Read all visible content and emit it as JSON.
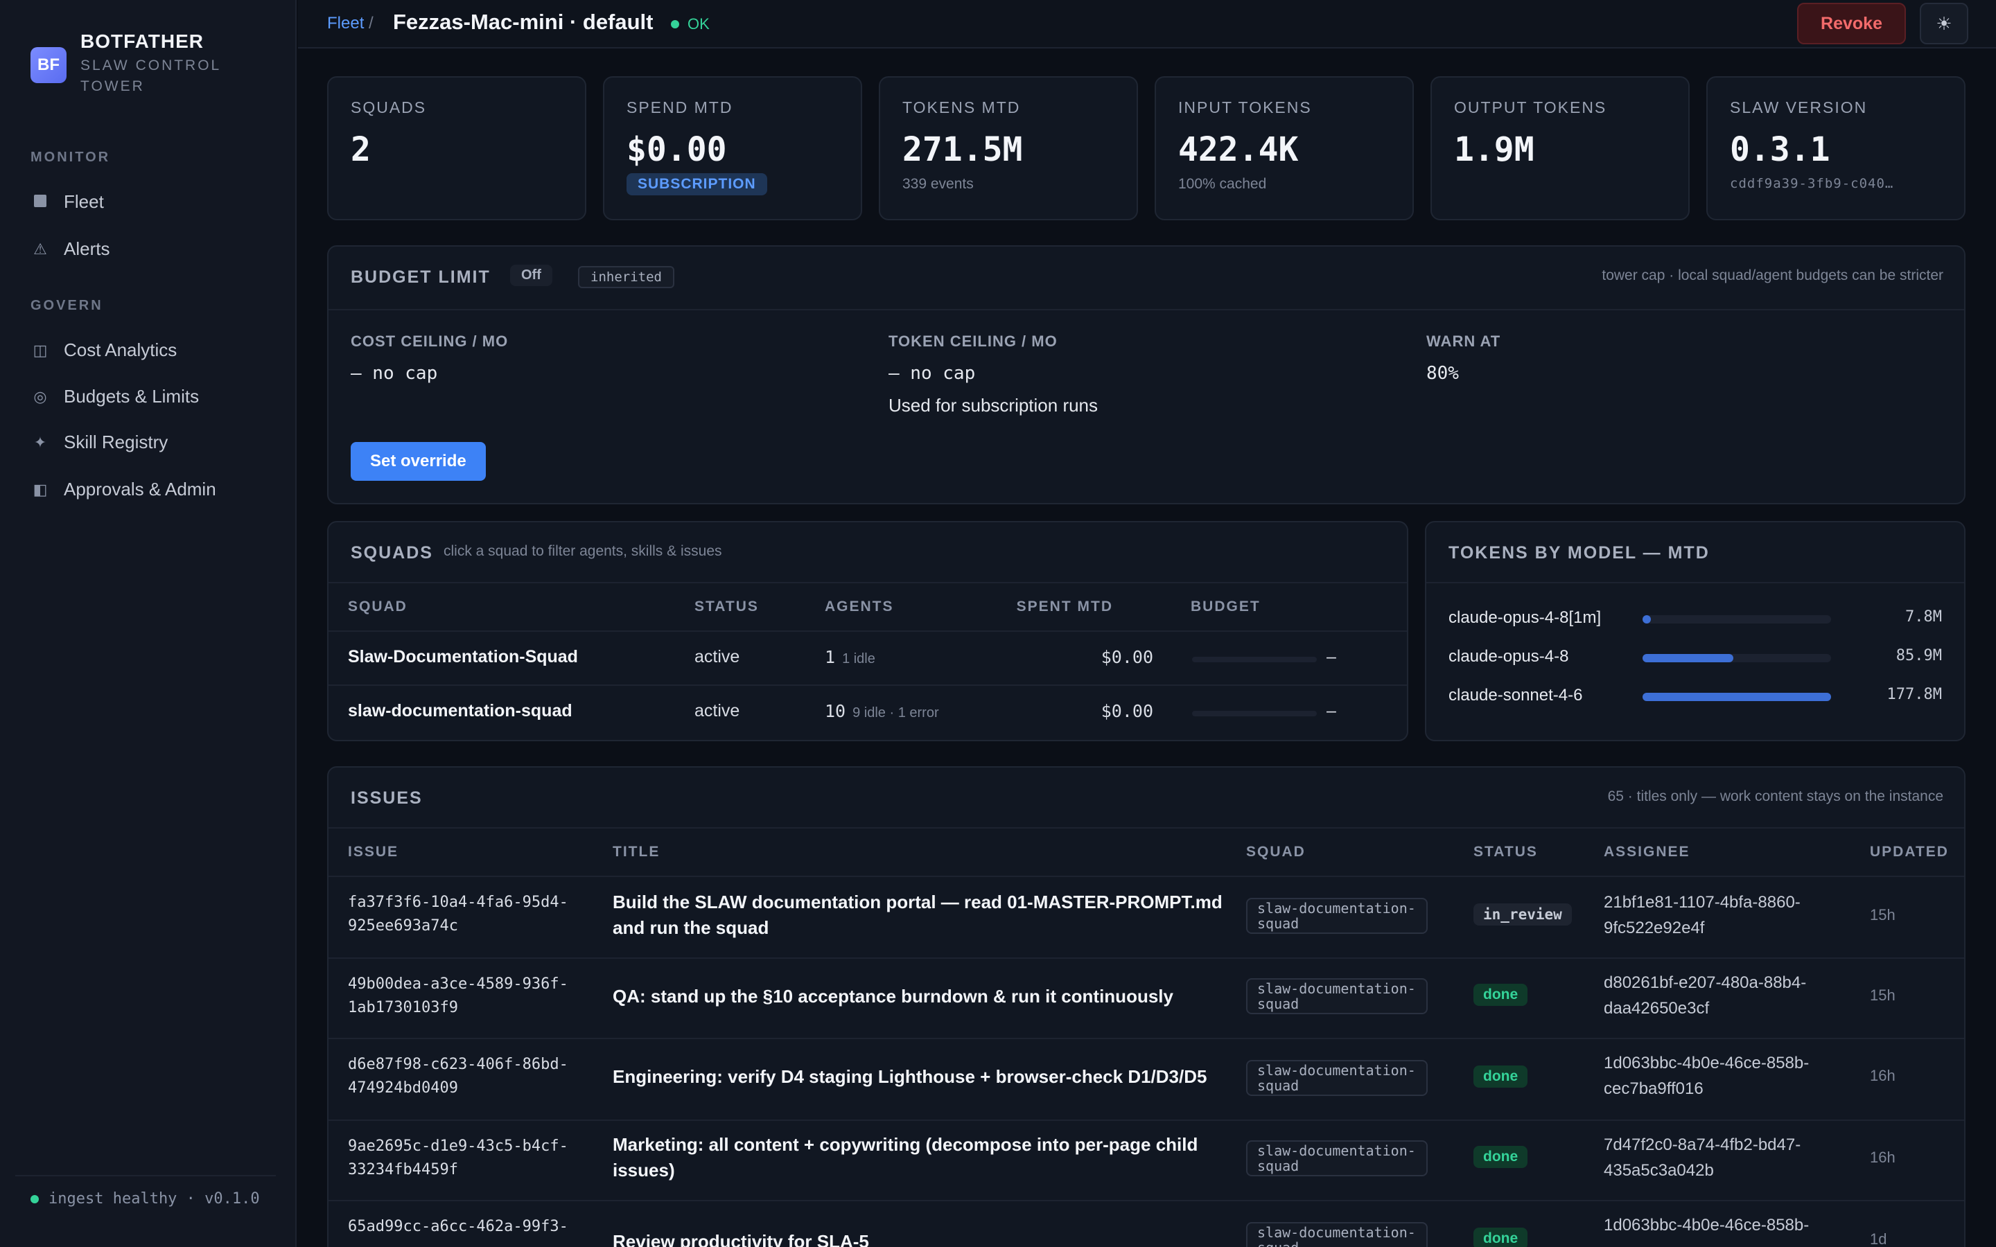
{
  "brand": {
    "logo": "BF",
    "name": "BOTFATHER",
    "subtitle": "SLAW CONTROL TOWER"
  },
  "sidebar": {
    "sections": [
      {
        "label": "MONITOR",
        "items": [
          {
            "label": "Fleet",
            "icon": "square-icon"
          },
          {
            "label": "Alerts",
            "icon": "warning-icon"
          }
        ]
      },
      {
        "label": "GOVERN",
        "items": [
          {
            "label": "Cost Analytics",
            "icon": "columns-icon"
          },
          {
            "label": "Budgets & Limits",
            "icon": "target-icon"
          },
          {
            "label": "Skill Registry",
            "icon": "sparkle-icon"
          },
          {
            "label": "Approvals & Admin",
            "icon": "admin-icon"
          }
        ]
      }
    ],
    "footer": "ingest healthy · v0.1.0"
  },
  "topbar": {
    "breadcrumb": "Fleet",
    "breadcrumb_sep": "/",
    "title": "Fezzas-Mac-mini · default",
    "status": "OK",
    "revoke_label": "Revoke",
    "theme_icon": "☀"
  },
  "stats": [
    {
      "label": "SQUADS",
      "value": "2"
    },
    {
      "label": "SPEND MTD",
      "value": "$0.00",
      "badge": "SUBSCRIPTION"
    },
    {
      "label": "TOKENS MTD",
      "value": "271.5M",
      "sub": "339 events"
    },
    {
      "label": "INPUT TOKENS",
      "value": "422.4K",
      "sub": "100% cached"
    },
    {
      "label": "OUTPUT TOKENS",
      "value": "1.9M"
    },
    {
      "label": "SLAW VERSION",
      "value": "0.3.1",
      "sub": "cddf9a39-3fb9-c040…"
    }
  ],
  "budget": {
    "title": "BUDGET LIMIT",
    "state": "Off",
    "inherited": "inherited",
    "hint": "tower cap · local squad/agent budgets can be stricter",
    "fields": [
      {
        "label": "COST CEILING / MO",
        "value": "— no cap"
      },
      {
        "label": "TOKEN CEILING / MO",
        "value": "— no cap",
        "note": "Used for subscription runs"
      },
      {
        "label": "WARN AT",
        "value": "80%"
      }
    ],
    "button": "Set override"
  },
  "squads": {
    "title": "SQUADS",
    "hint": "click a squad to filter agents, skills & issues",
    "columns": [
      "SQUAD",
      "STATUS",
      "AGENTS",
      "SPENT MTD",
      "BUDGET"
    ],
    "rows": [
      {
        "name": "Slaw-Documentation-Squad",
        "status": "active",
        "agents": "1",
        "agents_note": "1 idle",
        "spent": "$0.00",
        "budget": "–"
      },
      {
        "name": "slaw-documentation-squad",
        "status": "active",
        "agents": "10",
        "agents_note": "9 idle · 1 error",
        "spent": "$0.00",
        "budget": "–"
      }
    ]
  },
  "tokens_by_model": {
    "title": "TOKENS BY MODEL — MTD",
    "models": [
      {
        "name": "claude-opus-4-8[1m]",
        "value": "7.8M",
        "fraction": 0.044
      },
      {
        "name": "claude-opus-4-8",
        "value": "85.9M",
        "fraction": 0.483
      },
      {
        "name": "claude-sonnet-4-6",
        "value": "177.8M",
        "fraction": 1.0
      }
    ]
  },
  "issues": {
    "title": "ISSUES",
    "hint": "65 · titles only — work content stays on the instance",
    "columns": [
      "ISSUE",
      "TITLE",
      "SQUAD",
      "STATUS",
      "ASSIGNEE",
      "UPDATED"
    ],
    "rows": [
      {
        "id": "fa37f3f6-10a4-4fa6-95d4-925ee693a74c",
        "title": "Build the SLAW documentation portal — read 01-MASTER-PROMPT.md and run the squad",
        "squad": "slaw-documentation-squad",
        "status": "in_review",
        "assignee": "21bf1e81-1107-4bfa-8860-9fc522e92e4f",
        "updated": "15h"
      },
      {
        "id": "49b00dea-a3ce-4589-936f-1ab1730103f9",
        "title": "QA: stand up the §10 acceptance burndown & run it continuously",
        "squad": "slaw-documentation-squad",
        "status": "done",
        "assignee": "d80261bf-e207-480a-88b4-daa42650e3cf",
        "updated": "15h"
      },
      {
        "id": "d6e87f98-c623-406f-86bd-474924bd0409",
        "title": "Engineering: verify D4 staging Lighthouse + browser-check D1/D3/D5",
        "squad": "slaw-documentation-squad",
        "status": "done",
        "assignee": "1d063bbc-4b0e-46ce-858b-cec7ba9ff016",
        "updated": "16h"
      },
      {
        "id": "9ae2695c-d1e9-43c5-b4cf-33234fb4459f",
        "title": "Marketing: all content + copywriting (decompose into per-page child issues)",
        "squad": "slaw-documentation-squad",
        "status": "done",
        "assignee": "7d47f2c0-8a74-4fb2-bd47-435a5c3a042b",
        "updated": "16h"
      },
      {
        "id": "65ad99cc-a6cc-462a-99f3-",
        "title": "Review productivity for SLA-5",
        "squad": "slaw-documentation-squad",
        "status": "done",
        "assignee": "1d063bbc-4b0e-46ce-858b-",
        "updated": "1d"
      }
    ]
  },
  "colors": {
    "accent": "#3d82f6",
    "ok": "#34d399",
    "danger": "#f36b6b",
    "background": "#0b0f17"
  }
}
